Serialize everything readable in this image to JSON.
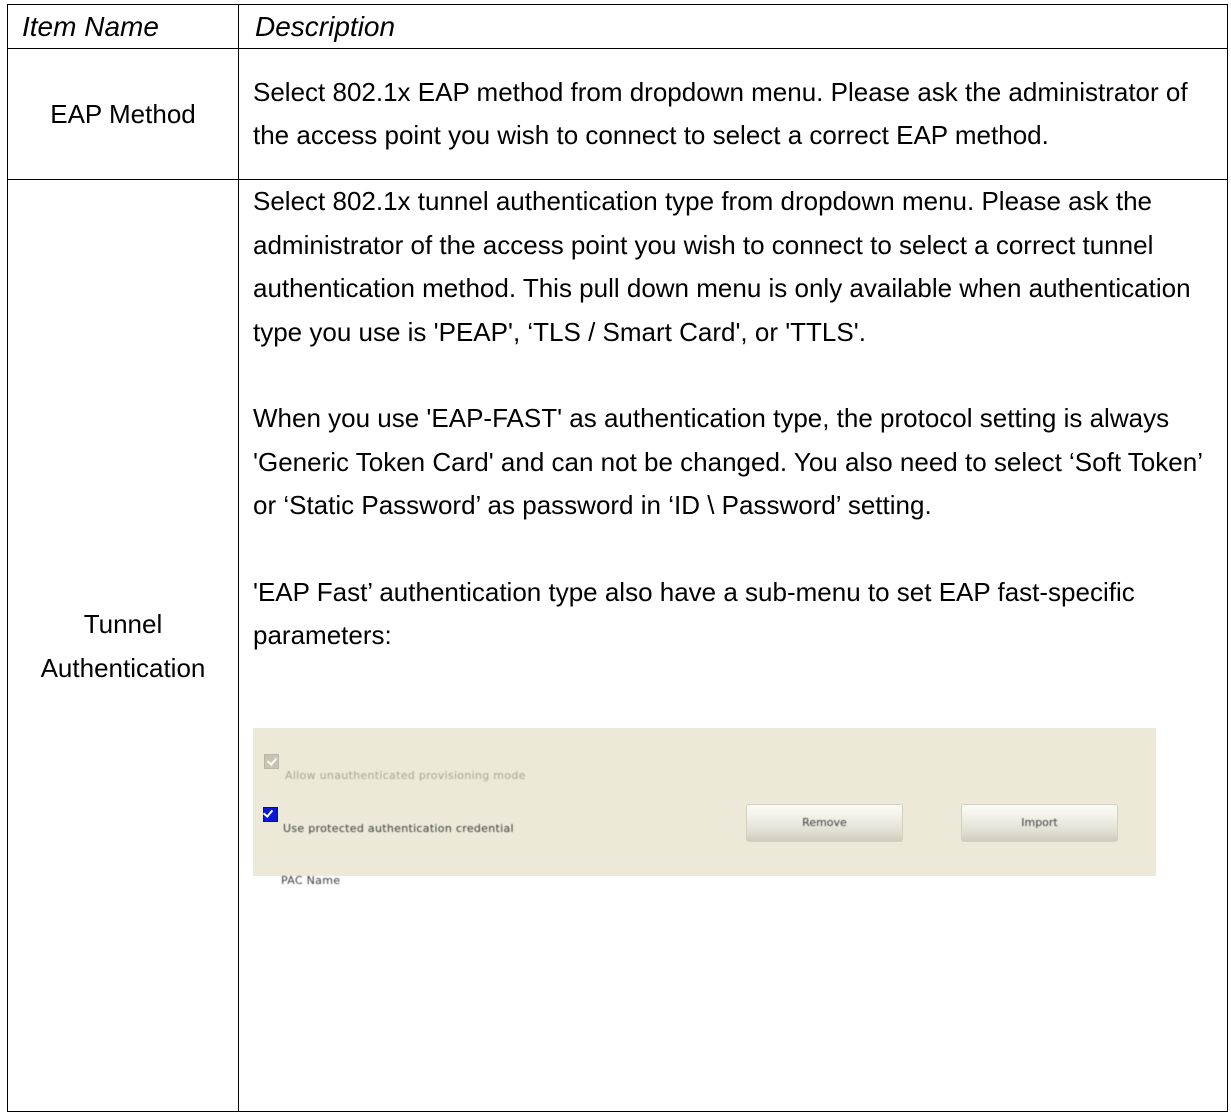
{
  "table": {
    "headers": {
      "item_name": "Item Name",
      "description": "Description"
    },
    "rows": [
      {
        "name": "EAP Method",
        "description": "Select 802.1x EAP method from dropdown menu. Please ask the administrator of the access point you wish to connect to select a correct EAP method."
      },
      {
        "name_line1": "Tunnel",
        "name_line2": "Authentication",
        "paragraphs": [
          "Select 802.1x tunnel authentication type from dropdown menu. Please ask the administrator of the access point you wish to connect to select a correct tunnel authentication method. This pull down menu is only available when authentication type you use is 'PEAP', ‘TLS / Smart Card', or 'TTLS'.",
          "When you use 'EAP-FAST' as authentication type, the protocol setting is always 'Generic Token Card' and can not be changed. You also need to select ‘Soft Token’ or ‘Static Password’ as password in ‘ID \\ Password’ setting.",
          "'EAP Fast’ authentication type also have a sub-menu to set EAP fast-specific parameters:"
        ]
      }
    ]
  },
  "eap_fast_panel": {
    "option1": {
      "label": "Allow unauthenticated provisioning mode",
      "checked": true,
      "enabled": false
    },
    "option2": {
      "label": "Use protected authentication credential",
      "checked": true,
      "enabled": true
    },
    "remove_button": "Remove",
    "import_button": "Import",
    "pac_label": "PAC Name"
  }
}
